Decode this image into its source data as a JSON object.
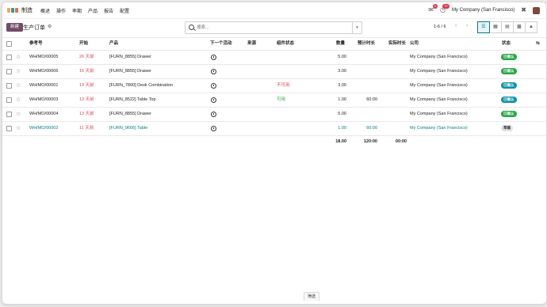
{
  "nav": {
    "app_name": "制造",
    "menu": [
      "概述",
      "操作",
      "率期",
      "产品",
      "报告",
      "配置"
    ],
    "msg_badge": "6",
    "activity_badge": "27",
    "company": "My Company (San Francisco)"
  },
  "control": {
    "new_label": "新建",
    "title": "生产订单",
    "search_placeholder": "搜索...",
    "pager": "1-6 / 6"
  },
  "columns": {
    "ref": "参考号",
    "start": "开始",
    "product": "产品",
    "activity": "下一个活动",
    "source": "来源",
    "component": "组件状态",
    "qty": "数量",
    "expected": "预计时长",
    "actual": "实际时长",
    "company": "公司",
    "status": "状态"
  },
  "rows": [
    {
      "ref": "WH/MO/00005",
      "start": "26 天前",
      "product": "[FURN_8855] Drawer",
      "component": "",
      "qty": "5.00",
      "expected": "",
      "company": "My Company (San Francisco)",
      "status": "已确认"
    },
    {
      "ref": "WH/MO/00006",
      "start": "16 天前",
      "product": "[FURN_8855] Drawer",
      "component": "",
      "qty": "3.00",
      "expected": "",
      "company": "My Company (San Francisco)",
      "status": "已确认"
    },
    {
      "ref": "WH/MO/00001",
      "start": "13 天前",
      "product": "[FURN_7800] Desk Combination",
      "component": "不可用",
      "qty": "3.00",
      "expected": "",
      "company": "My Company (San Francisco)",
      "status": "已确认"
    },
    {
      "ref": "WH/MO/00003",
      "start": "13 天前",
      "product": "[FURN_8522] Table Top",
      "component": "可用",
      "qty": "1.00",
      "expected": "60:00",
      "company": "My Company (San Francisco)",
      "status": "已确认"
    },
    {
      "ref": "WH/MO/00004",
      "start": "13 天前",
      "product": "[FURN_8855] Drawer",
      "component": "",
      "qty": "5.00",
      "expected": "",
      "company": "My Company (San Francisco)",
      "status": "已确认"
    },
    {
      "ref": "WH/MO/00002",
      "start": "11 天前",
      "product": "[FURN_9666] Table",
      "component": "",
      "qty": "1.00",
      "expected": "60:00",
      "company": "My Company (San Francisco)",
      "status": "草稿"
    }
  ],
  "totals": {
    "qty": "18.00",
    "expected": "120:00",
    "actual": "00:00"
  },
  "footer_tab": "筛选",
  "colors": {
    "primary": "#714b67",
    "teal": "#017e84",
    "red": "#d44c59",
    "green": "#28a745"
  }
}
